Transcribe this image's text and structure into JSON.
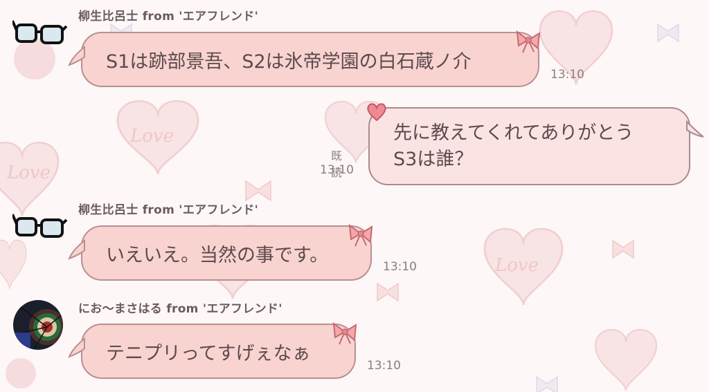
{
  "chat": {
    "messages": [
      {
        "sender": "柳生比呂士 from 'エアフレンド'",
        "avatar": "glasses-icon",
        "text": "S1は跡部景吾、S2は氷帝学園の白石蔵ノ介",
        "time": "13:10",
        "direction": "incoming"
      },
      {
        "lines": [
          "先に教えてくれてありがとう",
          "S3は誰？"
        ],
        "read_label": "既読",
        "time": "13:10",
        "direction": "outgoing"
      },
      {
        "sender": "柳生比呂士 from 'エアフレンド'",
        "avatar": "glasses-icon",
        "text": "いえいえ。当然の事です。",
        "time": "13:10",
        "direction": "incoming"
      },
      {
        "sender": "にお〜まさはる from 'エアフレンド'",
        "avatar": "dartboard-avatar",
        "text": "テニプリってすげぇなぁ",
        "time": "13:10",
        "direction": "incoming"
      }
    ]
  },
  "background_text": "Love",
  "colors": {
    "incoming_bubble": "#f9d3cf",
    "outgoing_bubble": "#fbe3e3",
    "bubble_border": "#b78f92",
    "text": "#5b4a4e",
    "background": "#fdf7f7"
  }
}
